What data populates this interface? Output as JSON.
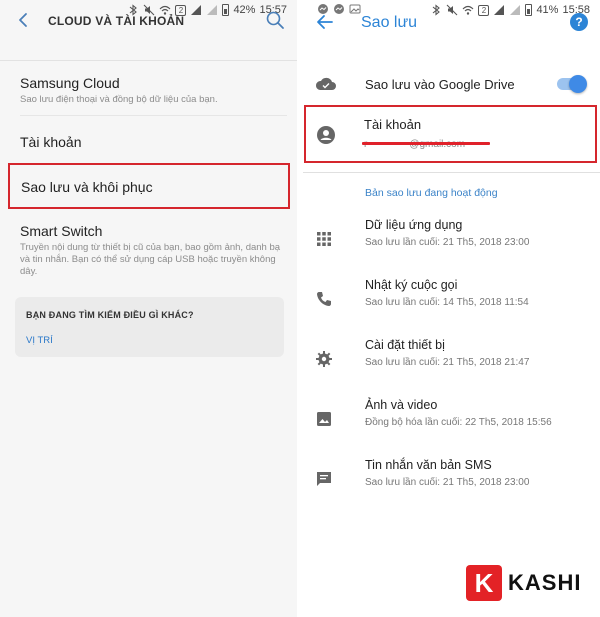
{
  "left_screen": {
    "status": {
      "battery": "42%",
      "time": "15:57",
      "sim_badge": "2"
    },
    "header": {
      "title": "CLOUD VÀ TÀI KHOẢN"
    },
    "items": [
      {
        "title": "Samsung Cloud",
        "subtitle": "Sao lưu điện thoại và đồng bộ dữ liệu của bạn."
      },
      {
        "title": "Tài khoản"
      },
      {
        "title": "Sao lưu và khôi phục"
      },
      {
        "title": "Smart Switch",
        "subtitle": "Truyền nội dung từ thiết bị cũ của bạn, bao gồm ảnh, danh bạ và tin nhắn. Bạn có thể sử dụng cáp USB hoặc truyền không dây."
      }
    ],
    "card": {
      "title": "BẠN ĐANG TÌM KIẾM ĐIỀU GÌ KHÁC?",
      "link": "VỊ TRÍ"
    },
    "highlight_color": "#d5262d"
  },
  "right_screen": {
    "status": {
      "battery": "41%",
      "time": "15:58",
      "sim_badge": "2"
    },
    "header": {
      "title": "Sao lưu"
    },
    "google_drive": {
      "label": "Sao lưu vào Google Drive",
      "enabled": true
    },
    "account": {
      "title": "Tài khoản",
      "email": "r••••••••••••@gmail.com"
    },
    "section_title": "Bản sao lưu đang hoạt động",
    "items": [
      {
        "title": "Dữ liệu ứng dụng",
        "subtitle": "Sao lưu lần cuối: 21 Th5, 2018 23:00",
        "icon": "apps-grid-icon"
      },
      {
        "title": "Nhật ký cuộc gọi",
        "subtitle": "Sao lưu lần cuối: 14 Th5, 2018 11:54",
        "icon": "phone-icon"
      },
      {
        "title": "Cài đặt thiết bị",
        "subtitle": "Sao lưu lần cuối: 21 Th5, 2018 21:47",
        "icon": "gear-icon"
      },
      {
        "title": "Ảnh và video",
        "subtitle": "Đồng bộ hóa lần cuối: 22 Th5, 2018 15:56",
        "icon": "image-icon"
      },
      {
        "title": "Tin nhắn văn bản SMS",
        "subtitle": "Sao lưu lần cuối: 21 Th5, 2018 23:00",
        "icon": "message-icon"
      }
    ],
    "accent_color": "#2c84d6"
  },
  "watermark": {
    "letter": "K",
    "text": "KASHI"
  }
}
